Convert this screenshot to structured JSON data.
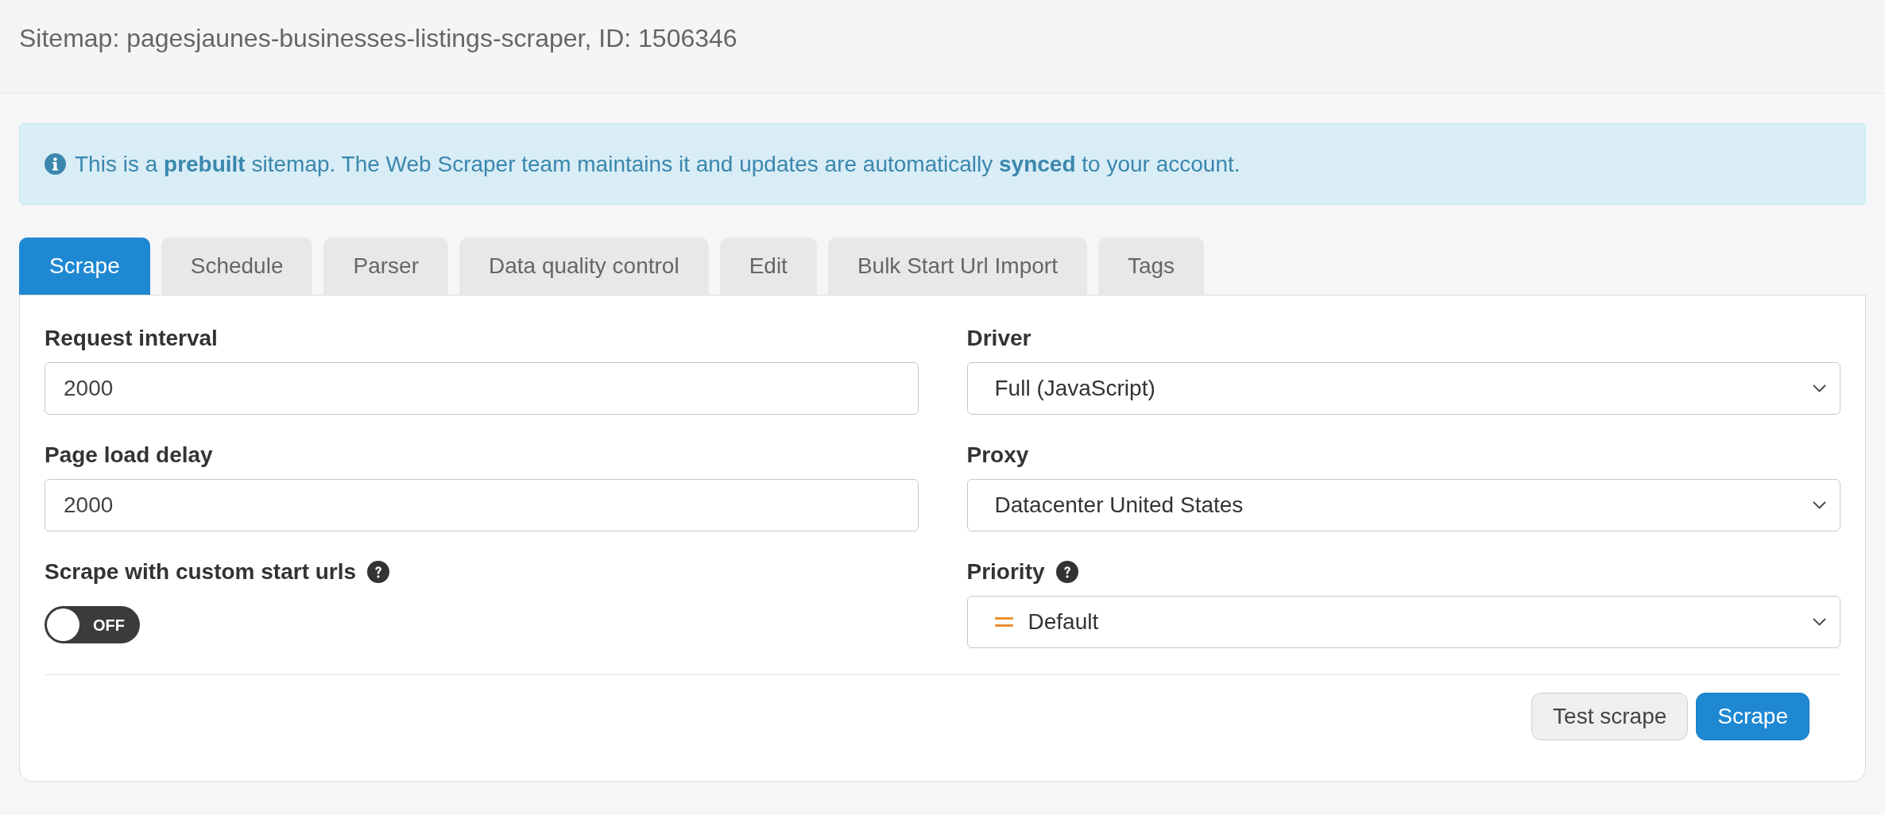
{
  "header": {
    "title": "Sitemap: pagesjaunes-businesses-listings-scraper, ID: 1506346"
  },
  "alert": {
    "text": "This is a **prebuilt** sitemap. The Web Scraper team maintains it and updates are automatically **synced** to your account."
  },
  "tabs": [
    {
      "label": "Scrape",
      "selected": true
    },
    {
      "label": "Schedule",
      "selected": false
    },
    {
      "label": "Parser",
      "selected": false
    },
    {
      "label": "Data quality control",
      "selected": false
    },
    {
      "label": "Edit",
      "selected": false
    },
    {
      "label": "Bulk Start Url Import",
      "selected": false
    },
    {
      "label": "Tags",
      "selected": false
    }
  ],
  "form": {
    "left": [
      {
        "kind": "input",
        "label": "Request interval",
        "help": false,
        "value": "2000"
      },
      {
        "kind": "input",
        "label": "Page load delay",
        "help": false,
        "value": "2000"
      },
      {
        "kind": "switch",
        "label": "Scrape with custom start urls",
        "help": true,
        "on": false,
        "state_text": "OFF"
      }
    ],
    "right": [
      {
        "kind": "select",
        "label": "Driver",
        "help": false,
        "value": "Full (JavaScript)"
      },
      {
        "kind": "select",
        "label": "Proxy",
        "help": false,
        "value": "Datacenter United States"
      },
      {
        "kind": "priority_select",
        "label": "Priority",
        "help": true,
        "value": "Default"
      }
    ]
  },
  "buttons": [
    {
      "kind": "default",
      "label": "Test scrape"
    },
    {
      "kind": "primary",
      "label": "Scrape"
    }
  ]
}
